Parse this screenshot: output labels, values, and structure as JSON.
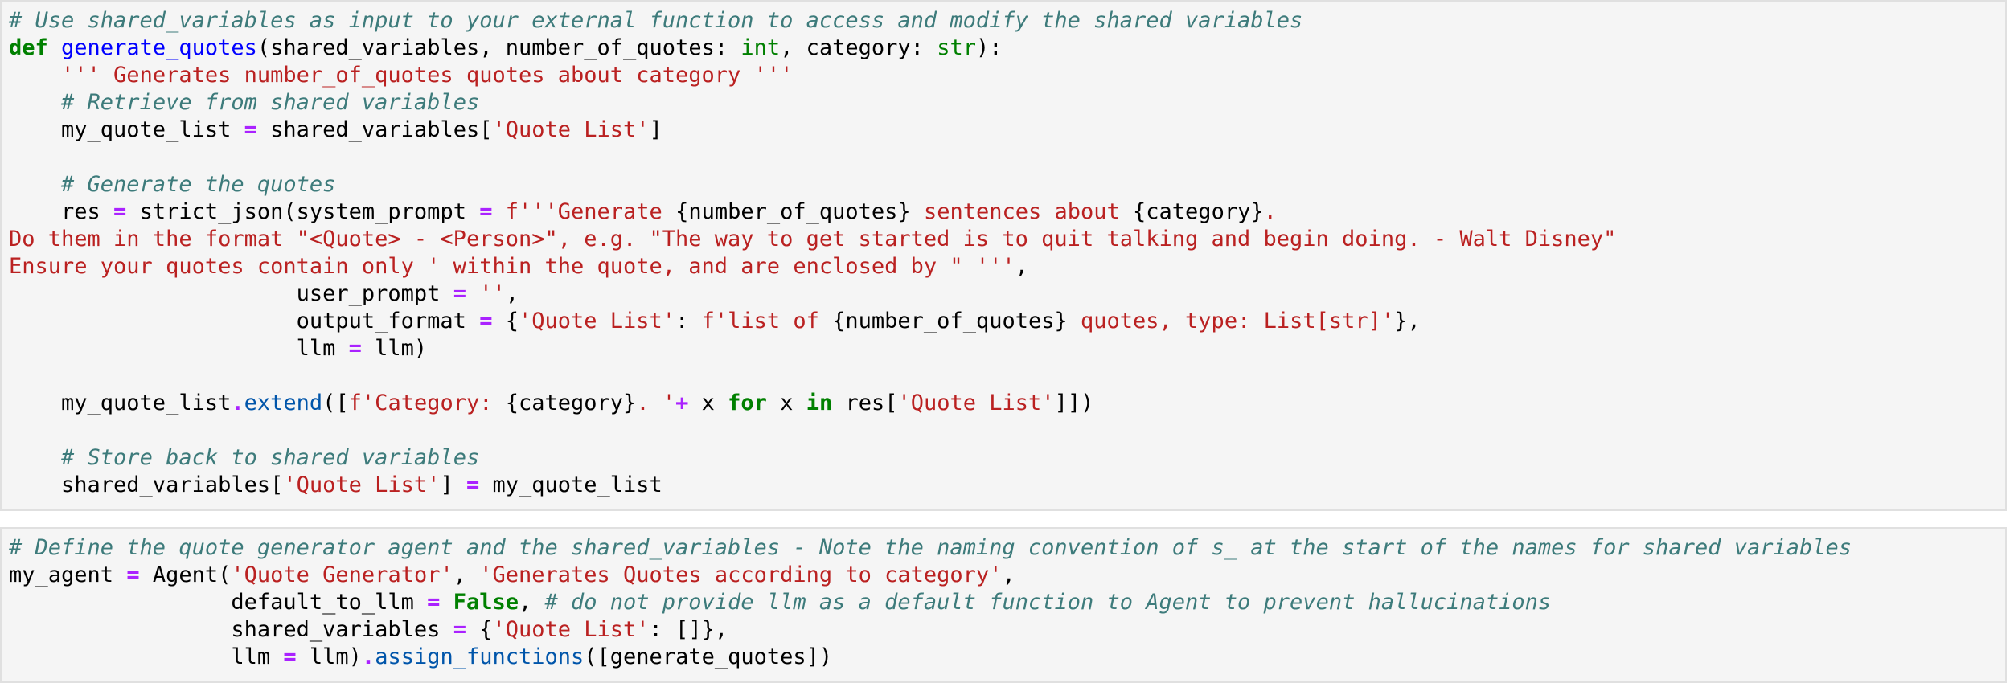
{
  "cells": [
    {
      "lines": [
        [
          {
            "c": "com",
            "t": "# Use shared_variables as input to your external function to access and modify the shared variables"
          }
        ],
        [
          {
            "c": "kw",
            "t": "def"
          },
          {
            "c": "plain",
            "t": " "
          },
          {
            "c": "fn",
            "t": "generate_quotes"
          },
          {
            "c": "plain",
            "t": "(shared_variables, number_of_quotes: "
          },
          {
            "c": "bi",
            "t": "int"
          },
          {
            "c": "plain",
            "t": ", category: "
          },
          {
            "c": "bi",
            "t": "str"
          },
          {
            "c": "plain",
            "t": "):"
          }
        ],
        [
          {
            "c": "plain",
            "t": "    "
          },
          {
            "c": "str",
            "t": "''' Generates number_of_quotes quotes about category '''"
          }
        ],
        [
          {
            "c": "plain",
            "t": "    "
          },
          {
            "c": "com",
            "t": "# Retrieve from shared variables"
          }
        ],
        [
          {
            "c": "plain",
            "t": "    my_quote_list "
          },
          {
            "c": "op",
            "t": "="
          },
          {
            "c": "plain",
            "t": " shared_variables["
          },
          {
            "c": "str",
            "t": "'Quote List'"
          },
          {
            "c": "plain",
            "t": "]"
          }
        ],
        [],
        [
          {
            "c": "plain",
            "t": "    "
          },
          {
            "c": "com",
            "t": "# Generate the quotes"
          }
        ],
        [
          {
            "c": "plain",
            "t": "    res "
          },
          {
            "c": "op",
            "t": "="
          },
          {
            "c": "plain",
            "t": " strict_json(system_prompt "
          },
          {
            "c": "op",
            "t": "="
          },
          {
            "c": "plain",
            "t": " "
          },
          {
            "c": "str",
            "t": "f'''Generate "
          },
          {
            "c": "plain",
            "t": "{number_of_quotes}"
          },
          {
            "c": "str",
            "t": " sentences about "
          },
          {
            "c": "plain",
            "t": "{category}"
          },
          {
            "c": "str",
            "t": "."
          }
        ],
        [
          {
            "c": "str",
            "t": "Do them in the format \"<Quote> - <Person>\", e.g. \"The way to get started is to quit talking and begin doing. - Walt Disney\""
          }
        ],
        [
          {
            "c": "str",
            "t": "Ensure your quotes contain only ' within the quote, and are enclosed by \" '''"
          },
          {
            "c": "plain",
            "t": ","
          }
        ],
        [
          {
            "c": "plain",
            "t": "                      user_prompt "
          },
          {
            "c": "op",
            "t": "="
          },
          {
            "c": "plain",
            "t": " "
          },
          {
            "c": "str",
            "t": "''"
          },
          {
            "c": "plain",
            "t": ","
          }
        ],
        [
          {
            "c": "plain",
            "t": "                      output_format "
          },
          {
            "c": "op",
            "t": "="
          },
          {
            "c": "plain",
            "t": " {"
          },
          {
            "c": "str",
            "t": "'Quote List'"
          },
          {
            "c": "plain",
            "t": ": "
          },
          {
            "c": "str",
            "t": "f'list of "
          },
          {
            "c": "plain",
            "t": "{number_of_quotes}"
          },
          {
            "c": "str",
            "t": " quotes, type: List[str]'"
          },
          {
            "c": "plain",
            "t": "},"
          }
        ],
        [
          {
            "c": "plain",
            "t": "                      llm "
          },
          {
            "c": "op",
            "t": "="
          },
          {
            "c": "plain",
            "t": " llm)"
          }
        ],
        [],
        [
          {
            "c": "plain",
            "t": "    my_quote_list"
          },
          {
            "c": "op",
            "t": "."
          },
          {
            "c": "attr",
            "t": "extend"
          },
          {
            "c": "plain",
            "t": "(["
          },
          {
            "c": "str",
            "t": "f'Category: "
          },
          {
            "c": "plain",
            "t": "{category}"
          },
          {
            "c": "str",
            "t": ". '"
          },
          {
            "c": "op",
            "t": "+"
          },
          {
            "c": "plain",
            "t": " x "
          },
          {
            "c": "kw",
            "t": "for"
          },
          {
            "c": "plain",
            "t": " x "
          },
          {
            "c": "kw",
            "t": "in"
          },
          {
            "c": "plain",
            "t": " res["
          },
          {
            "c": "str",
            "t": "'Quote List'"
          },
          {
            "c": "plain",
            "t": "]])"
          }
        ],
        [],
        [
          {
            "c": "plain",
            "t": "    "
          },
          {
            "c": "com",
            "t": "# Store back to shared variables"
          }
        ],
        [
          {
            "c": "plain",
            "t": "    shared_variables["
          },
          {
            "c": "str",
            "t": "'Quote List'"
          },
          {
            "c": "plain",
            "t": "] "
          },
          {
            "c": "op",
            "t": "="
          },
          {
            "c": "plain",
            "t": " my_quote_list"
          }
        ]
      ]
    },
    {
      "lines": [
        [
          {
            "c": "com",
            "t": "# Define the quote generator agent and the shared_variables - Note the naming convention of s_ at the start of the names for shared variables"
          }
        ],
        [
          {
            "c": "plain",
            "t": "my_agent "
          },
          {
            "c": "op",
            "t": "="
          },
          {
            "c": "plain",
            "t": " Agent("
          },
          {
            "c": "str",
            "t": "'Quote Generator'"
          },
          {
            "c": "plain",
            "t": ", "
          },
          {
            "c": "str",
            "t": "'Generates Quotes according to category'"
          },
          {
            "c": "plain",
            "t": ","
          }
        ],
        [
          {
            "c": "plain",
            "t": "                 default_to_llm "
          },
          {
            "c": "op",
            "t": "="
          },
          {
            "c": "plain",
            "t": " "
          },
          {
            "c": "kw",
            "t": "False"
          },
          {
            "c": "plain",
            "t": ", "
          },
          {
            "c": "com",
            "t": "# do not provide llm as a default function to Agent to prevent hallucinations"
          }
        ],
        [
          {
            "c": "plain",
            "t": "                 shared_variables "
          },
          {
            "c": "op",
            "t": "="
          },
          {
            "c": "plain",
            "t": " {"
          },
          {
            "c": "str",
            "t": "'Quote List'"
          },
          {
            "c": "plain",
            "t": ": []},"
          }
        ],
        [
          {
            "c": "plain",
            "t": "                 llm "
          },
          {
            "c": "op",
            "t": "="
          },
          {
            "c": "plain",
            "t": " llm)"
          },
          {
            "c": "op",
            "t": "."
          },
          {
            "c": "attr",
            "t": "assign_functions"
          },
          {
            "c": "plain",
            "t": "([generate_quotes])"
          }
        ]
      ]
    }
  ]
}
